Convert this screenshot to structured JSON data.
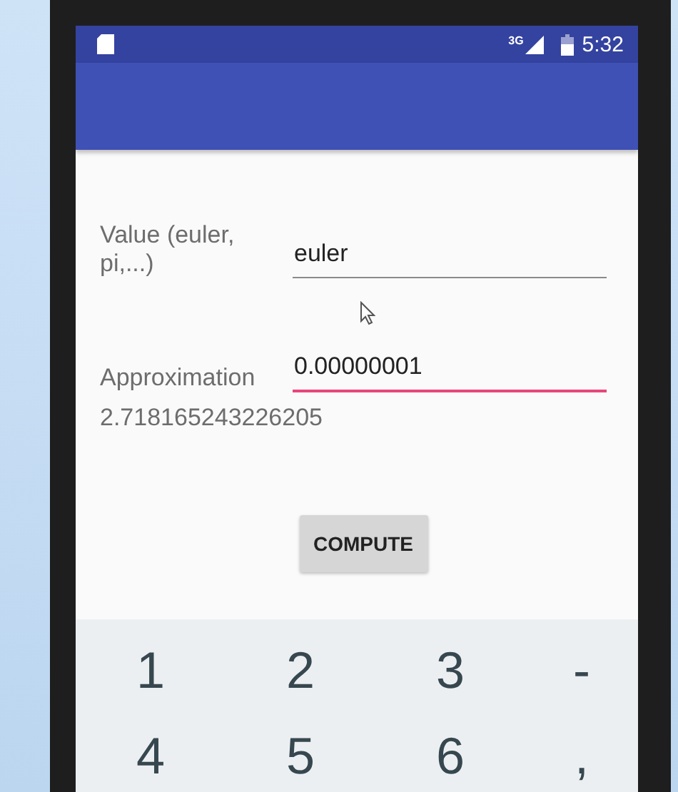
{
  "status_bar": {
    "network": "3G",
    "time": "5:32"
  },
  "form": {
    "fields": [
      {
        "label": "Value (euler, pi,...)",
        "value": "euler",
        "focused": false
      },
      {
        "label": "Approximation",
        "value": "0.00000001",
        "focused": true
      }
    ],
    "result": "2.718165243226205",
    "button": "COMPUTE"
  },
  "keyboard": {
    "rows": [
      [
        "1",
        "2",
        "3",
        "-"
      ],
      [
        "4",
        "5",
        "6",
        ","
      ]
    ]
  }
}
